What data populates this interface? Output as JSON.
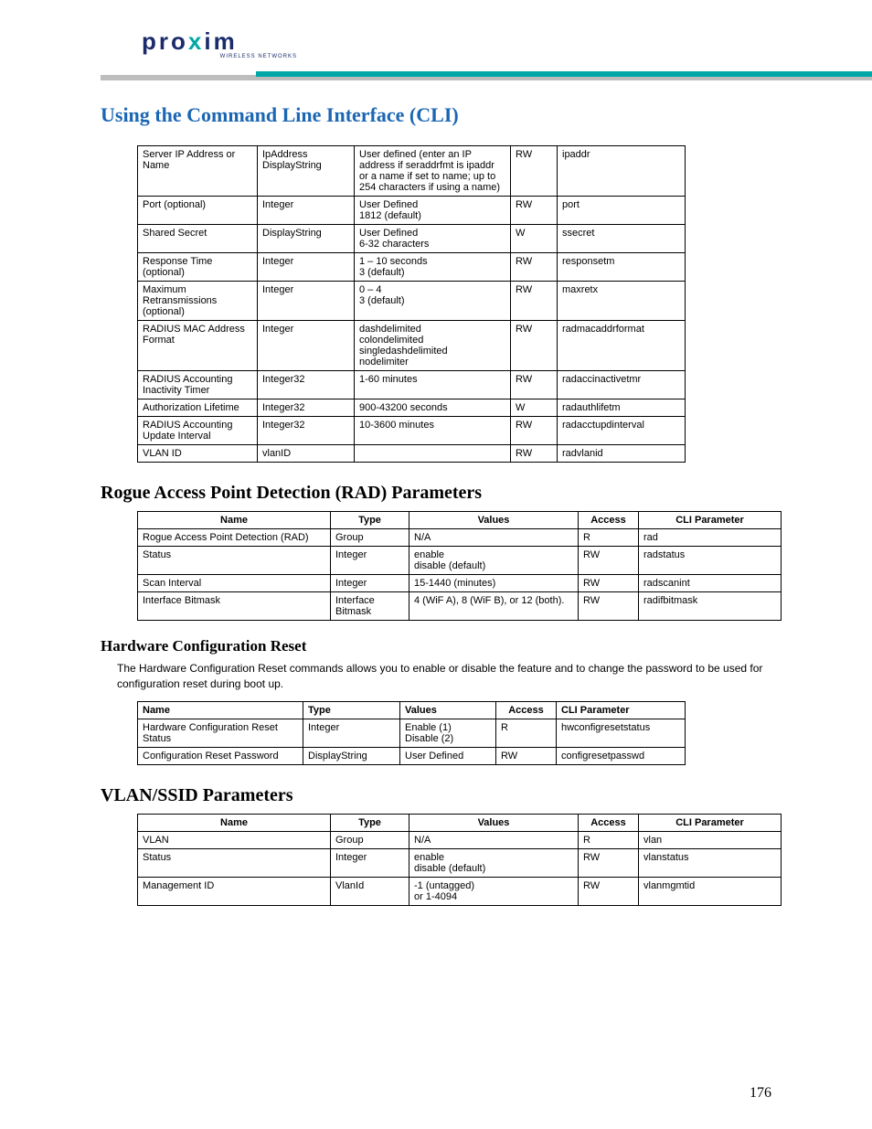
{
  "logo": {
    "brand": "pro",
    "x": "x",
    "brand2": "im",
    "sub": "WIRELESS NETWORKS"
  },
  "page_title": "Using the Command Line Interface (CLI)",
  "page_number": "176",
  "table1": {
    "rows": [
      {
        "name": "Server IP Address or Name",
        "type": "IpAddress DisplayString",
        "values": "User defined (enter an IP address if seraddrfmt is ipaddr or a name if set to name; up to 254 characters if using a name)",
        "access": "RW",
        "cli": "ipaddr"
      },
      {
        "name": "Port (optional)",
        "type": "Integer",
        "values": "User Defined\n1812 (default)",
        "access": "RW",
        "cli": "port"
      },
      {
        "name": "Shared Secret",
        "type": "DisplayString",
        "values": "User Defined\n6-32 characters",
        "access": "W",
        "cli": "ssecret"
      },
      {
        "name": "Response Time (optional)",
        "type": "Integer",
        "values": "1 – 10 seconds\n3 (default)",
        "access": "RW",
        "cli": "responsetm"
      },
      {
        "name": "Maximum Retransmissions (optional)",
        "type": "Integer",
        "values": "0 – 4\n3 (default)",
        "access": "RW",
        "cli": "maxretx"
      },
      {
        "name": "RADIUS MAC Address Format",
        "type": "Integer",
        "values": "dashdelimited\ncolondelimited\nsingledashdelimited\nnodelimiter",
        "access": "RW",
        "cli": "radmacaddrformat"
      },
      {
        "name": "RADIUS Accounting Inactivity Timer",
        "type": "Integer32",
        "values": "1-60 minutes",
        "access": "RW",
        "cli": "radaccinactivetmr"
      },
      {
        "name": "Authorization Lifetime",
        "type": "Integer32",
        "values": "900-43200 seconds",
        "access": "W",
        "cli": "radauthlifetm"
      },
      {
        "name": "RADIUS Accounting Update Interval",
        "type": "Integer32",
        "values": "10-3600 minutes",
        "access": "RW",
        "cli": "radacctupdinterval"
      },
      {
        "name": "VLAN ID",
        "type": "vlanID",
        "values": "",
        "access": "RW",
        "cli": "radvlanid"
      }
    ]
  },
  "rad_heading": "Rogue Access Point Detection (RAD) Parameters",
  "table_rad": {
    "headers": {
      "name": "Name",
      "type": "Type",
      "values": "Values",
      "access": "Access",
      "cli": "CLI Parameter"
    },
    "rows": [
      {
        "name": "Rogue Access Point Detection (RAD)",
        "type": "Group",
        "values": "N/A",
        "access": "R",
        "cli": "rad"
      },
      {
        "name": "Status",
        "type": "Integer",
        "values": "enable\ndisable (default)",
        "access": "RW",
        "cli": "radstatus"
      },
      {
        "name": "Scan Interval",
        "type": "Integer",
        "values": "15-1440 (minutes)",
        "access": "RW",
        "cli": "radscanint"
      },
      {
        "name": "Interface Bitmask",
        "type": "Interface Bitmask",
        "values": "4 (WiF A), 8 (WiF B), or 12 (both).",
        "access": "RW",
        "cli": "radifbitmask"
      }
    ]
  },
  "hcr_heading": "Hardware Configuration Reset",
  "hcr_para": "The Hardware Configuration Reset commands allows you to enable or disable the feature and to change the password to be used for configuration reset during boot up.",
  "table_hcr": {
    "headers": {
      "name": "Name",
      "type": "Type",
      "values": "Values",
      "access": "Access",
      "cli": "CLI Parameter"
    },
    "rows": [
      {
        "name": "Hardware Configuration Reset Status",
        "type": "Integer",
        "values": "Enable (1)\nDisable (2)",
        "access": "R",
        "cli": "hwconfigresetstatus"
      },
      {
        "name": "Configuration Reset Password",
        "type": "DisplayString",
        "values": "User Defined",
        "access": "RW",
        "cli": "configresetpasswd"
      }
    ]
  },
  "vlan_heading": "VLAN/SSID Parameters",
  "table_vlan": {
    "headers": {
      "name": "Name",
      "type": "Type",
      "values": "Values",
      "access": "Access",
      "cli": "CLI Parameter"
    },
    "rows": [
      {
        "name": "VLAN",
        "type": "Group",
        "values": "N/A",
        "access": "R",
        "cli": "vlan"
      },
      {
        "name": "Status",
        "type": "Integer",
        "values": "enable\ndisable (default)",
        "access": "RW",
        "cli": "vlanstatus"
      },
      {
        "name": "Management ID",
        "type": "VlanId",
        "values": "-1 (untagged)\nor 1-4094",
        "access": "RW",
        "cli": "vlanmgmtid"
      }
    ]
  }
}
